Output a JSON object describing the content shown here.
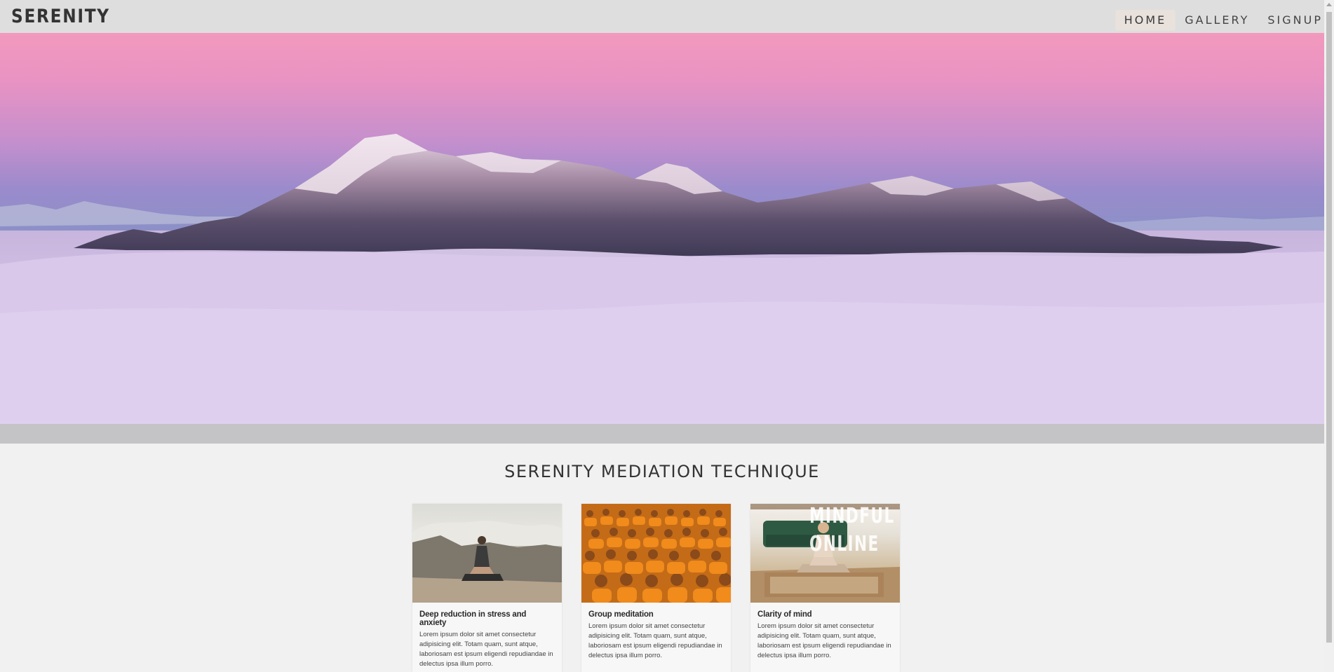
{
  "header": {
    "brand": "SERENITY",
    "nav": [
      {
        "label": "HOME",
        "active": true
      },
      {
        "label": "GALLERY",
        "active": false
      },
      {
        "label": "SIGNUP",
        "active": false
      }
    ]
  },
  "hero": {
    "image": "mountain-above-clouds-at-dusk"
  },
  "section": {
    "title": "SERENITY MEDIATION TECHNIQUE"
  },
  "cards": [
    {
      "title": "Deep reduction in stress and anxiety",
      "text": "Lorem ipsum dolor sit amet consectetur adipisicing elit. Totam quam, sunt atque, laboriosam est ipsum eligendi repudiandae in delectus ipsa illum porro.",
      "image": "woman-meditating-on-rock"
    },
    {
      "title": "Group meditation",
      "text": "Lorem ipsum dolor sit amet consectetur adipisicing elit. Totam quam, sunt atque, laboriosam est ipsum eligendi repudiandae in delectus ipsa illum porro.",
      "image": "monks-in-orange-robes"
    },
    {
      "title": "Clarity of mind",
      "text": "Lorem ipsum dolor sit amet consectetur adipisicing elit. Totam quam, sunt atque, laboriosam est ipsum eligendi repudiandae in delectus ipsa illum porro.",
      "image": "mindful-online-meditation",
      "overlay_lines": [
        "MINDFUL",
        "ONLINE"
      ]
    }
  ],
  "colors": {
    "topbar": "#dedede",
    "band": "#c4c3c5",
    "background": "#f1f1f1",
    "nav_active": "#e8e1dc"
  }
}
